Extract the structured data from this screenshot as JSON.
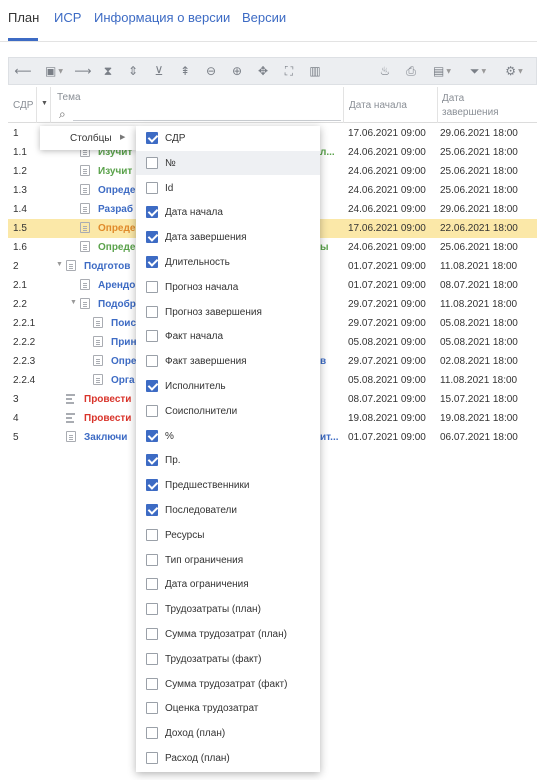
{
  "tabs": [
    {
      "label": "План",
      "active": true
    },
    {
      "label": "ИСР",
      "active": false
    },
    {
      "label": "Информация о версии",
      "active": false
    },
    {
      "label": "Версии",
      "active": false
    }
  ],
  "toolbar": {
    "icons": [
      "arrow-left-icon",
      "calendar-check-icon",
      "arrow-right-icon",
      "collapse-all-icon",
      "expand-all-icon",
      "collapse-icon",
      "expand-icon",
      "zoom-out-icon",
      "zoom-in-icon",
      "move-icon",
      "fit-icon",
      "chart-icon",
      "critical-path-icon",
      "print-icon",
      "calendar-icon",
      "filter-icon",
      "settings-icon"
    ]
  },
  "grid": {
    "headers": {
      "sdr": "СДР",
      "topic": "Тема",
      "start": "Дата начала",
      "end_line1": "Дата",
      "end_line2": "завершения"
    },
    "rows": [
      {
        "sdr": "1",
        "name": "",
        "tail": "",
        "start": "17.06.2021 09:00",
        "end": "29.06.2021 18:00",
        "color": "blue"
      },
      {
        "sdr": "1.1",
        "name": "Изучит",
        "tail": "л...",
        "start": "24.06.2021 09:00",
        "end": "25.06.2021 18:00",
        "color": "green"
      },
      {
        "sdr": "1.2",
        "name": "Изучит",
        "tail": "",
        "start": "24.06.2021 09:00",
        "end": "25.06.2021 18:00",
        "color": "green"
      },
      {
        "sdr": "1.3",
        "name": "Опреде",
        "tail": "",
        "start": "24.06.2021 09:00",
        "end": "25.06.2021 18:00",
        "color": "blue"
      },
      {
        "sdr": "1.4",
        "name": "Разраб",
        "tail": "",
        "start": "24.06.2021 09:00",
        "end": "29.06.2021 18:00",
        "color": "blue"
      },
      {
        "sdr": "1.5",
        "name": "Опреде",
        "tail": "",
        "start": "17.06.2021 09:00",
        "end": "22.06.2021 18:00",
        "color": "orange"
      },
      {
        "sdr": "1.6",
        "name": "Опреде",
        "tail": "ы",
        "start": "24.06.2021 09:00",
        "end": "25.06.2021 18:00",
        "color": "green"
      },
      {
        "sdr": "2",
        "name": "Подготов",
        "tail": "",
        "start": "01.07.2021 09:00",
        "end": "11.08.2021 18:00",
        "color": "blue"
      },
      {
        "sdr": "2.1",
        "name": "Арендо",
        "tail": "",
        "start": "01.07.2021 09:00",
        "end": "08.07.2021 18:00",
        "color": "blue"
      },
      {
        "sdr": "2.2",
        "name": "Подобр",
        "tail": "",
        "start": "29.07.2021 09:00",
        "end": "11.08.2021 18:00",
        "color": "blue"
      },
      {
        "sdr": "2.2.1",
        "name": "Поис",
        "tail": "",
        "start": "29.07.2021 09:00",
        "end": "05.08.2021 18:00",
        "color": "blue"
      },
      {
        "sdr": "2.2.2",
        "name": "Прин",
        "tail": "",
        "start": "05.08.2021 09:00",
        "end": "05.08.2021 18:00",
        "color": "blue"
      },
      {
        "sdr": "2.2.3",
        "name": "Опре",
        "tail": "в",
        "start": "29.07.2021 09:00",
        "end": "02.08.2021 18:00",
        "color": "blue"
      },
      {
        "sdr": "2.2.4",
        "name": "Орга",
        "tail": "",
        "start": "05.08.2021 09:00",
        "end": "11.08.2021 18:00",
        "color": "blue"
      },
      {
        "sdr": "3",
        "name": "Провести",
        "tail": "",
        "start": "08.07.2021 09:00",
        "end": "15.07.2021 18:00",
        "color": "red"
      },
      {
        "sdr": "4",
        "name": "Провести",
        "tail": "",
        "start": "19.08.2021 09:00",
        "end": "19.08.2021 18:00",
        "color": "red"
      },
      {
        "sdr": "5",
        "name": "Заключи",
        "tail": "ит...",
        "start": "01.07.2021 09:00",
        "end": "06.07.2021 18:00",
        "color": "blue"
      }
    ]
  },
  "context_menu": {
    "columns_label": "Столбцы"
  },
  "columns_menu": [
    {
      "label": "СДР",
      "checked": true
    },
    {
      "label": "№",
      "checked": false
    },
    {
      "label": "Id",
      "checked": false
    },
    {
      "label": "Дата начала",
      "checked": true
    },
    {
      "label": "Дата завершения",
      "checked": true
    },
    {
      "label": "Длительность",
      "checked": true
    },
    {
      "label": "Прогноз начала",
      "checked": false
    },
    {
      "label": "Прогноз завершения",
      "checked": false
    },
    {
      "label": "Факт начала",
      "checked": false
    },
    {
      "label": "Факт завершения",
      "checked": false
    },
    {
      "label": "Исполнитель",
      "checked": true
    },
    {
      "label": "Соисполнители",
      "checked": false
    },
    {
      "label": "%",
      "checked": true
    },
    {
      "label": "Пр.",
      "checked": true
    },
    {
      "label": "Предшественники",
      "checked": true
    },
    {
      "label": "Последователи",
      "checked": true
    },
    {
      "label": "Ресурсы",
      "checked": false
    },
    {
      "label": "Тип ограничения",
      "checked": false
    },
    {
      "label": "Дата ограничения",
      "checked": false
    },
    {
      "label": "Трудозатраты (план)",
      "checked": false
    },
    {
      "label": "Сумма трудозатрат (план)",
      "checked": false
    },
    {
      "label": "Трудозатраты (факт)",
      "checked": false
    },
    {
      "label": "Сумма трудозатрат (факт)",
      "checked": false
    },
    {
      "label": "Оценка трудозатрат",
      "checked": false
    },
    {
      "label": "Доход (план)",
      "checked": false
    },
    {
      "label": "Расход (план)",
      "checked": false
    }
  ]
}
